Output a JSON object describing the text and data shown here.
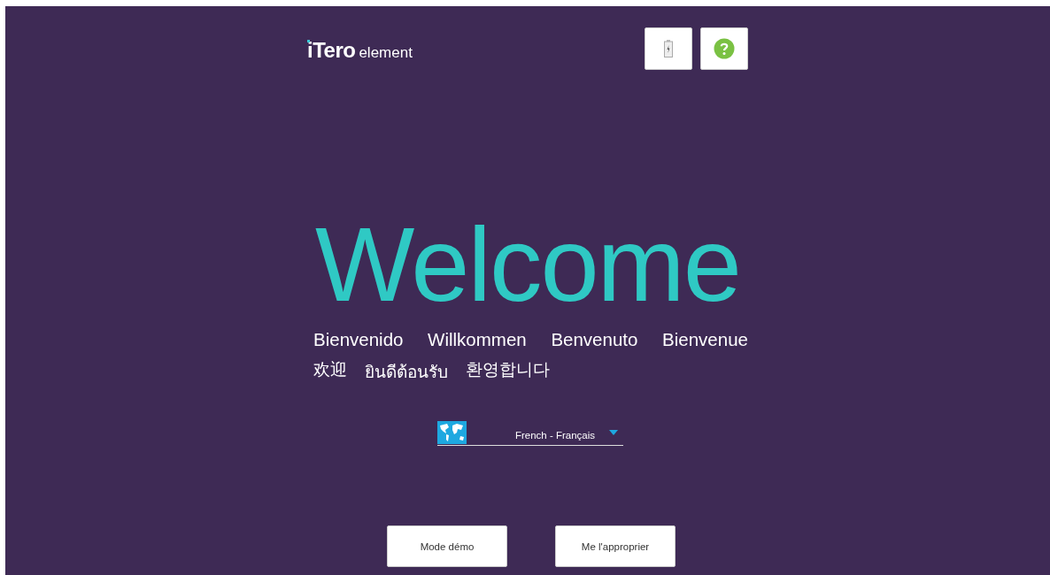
{
  "logo": {
    "brand": "iTero",
    "product": "element"
  },
  "title": "Welcome",
  "greetings": [
    [
      "Bienvenido",
      "Willkommen",
      "Benvenuto",
      "Bienvenue"
    ],
    [
      "欢迎",
      "ยินดีต้อนรับ",
      "환영합니다"
    ]
  ],
  "language": {
    "value": "French - Français"
  },
  "buttons": [
    "Mode démo",
    "Me l'approprier"
  ]
}
